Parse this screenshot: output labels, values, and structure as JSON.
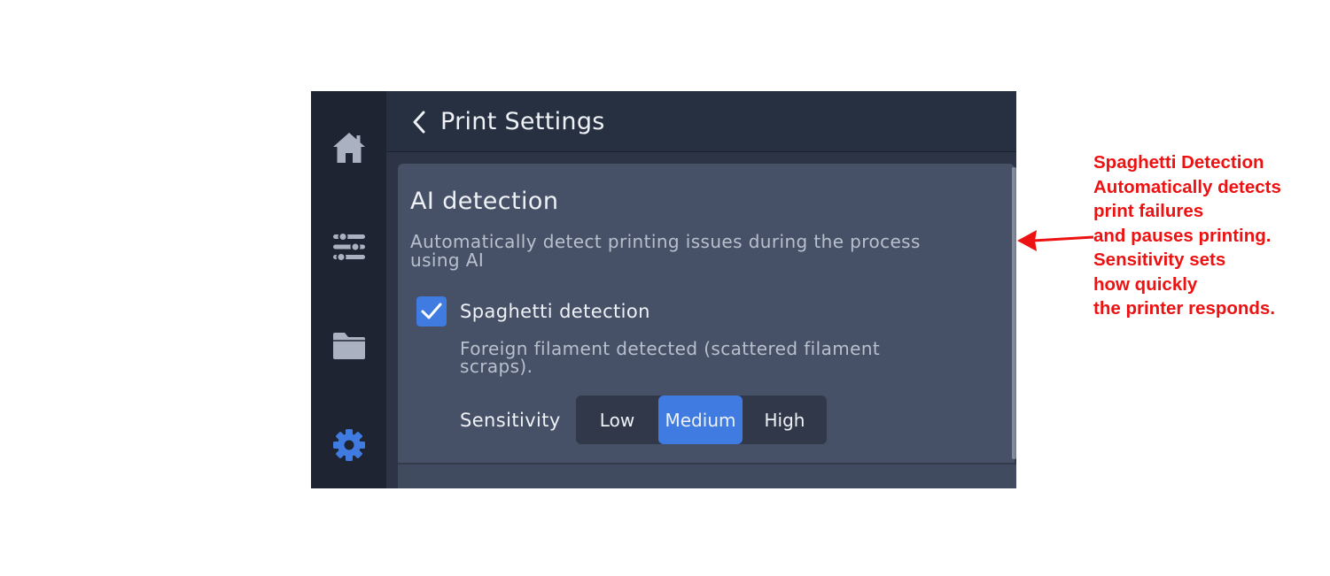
{
  "header": {
    "title": "Print Settings"
  },
  "sidebar": {
    "items": [
      {
        "icon": "home-icon",
        "color": "#aab2c2"
      },
      {
        "icon": "sliders-icon",
        "color": "#aab2c2"
      },
      {
        "icon": "folder-icon",
        "color": "#aab2c2"
      },
      {
        "icon": "gear-icon",
        "color": "#3f7be0",
        "active": true
      }
    ]
  },
  "section": {
    "title": "AI detection",
    "description": "Automatically detect printing issues during the process using AI"
  },
  "spaghetti": {
    "label": "Spaghetti detection",
    "checked": true,
    "description": "Foreign filament detected (scattered filament scraps)."
  },
  "sensitivity": {
    "label": "Sensitivity",
    "options": [
      "Low",
      "Medium",
      "High"
    ],
    "selected": "Medium"
  },
  "annotation": {
    "lines": [
      "Spaghetti Detection",
      "Automatically detects",
      "print failures",
      "and pauses printing.",
      "Sensitivity sets",
      "how quickly",
      "the printer responds."
    ],
    "color": "#ee1111"
  },
  "colors": {
    "accent": "#3f7be0",
    "sidebar_bg": "#1f2433",
    "panel_bg": "#465167"
  }
}
